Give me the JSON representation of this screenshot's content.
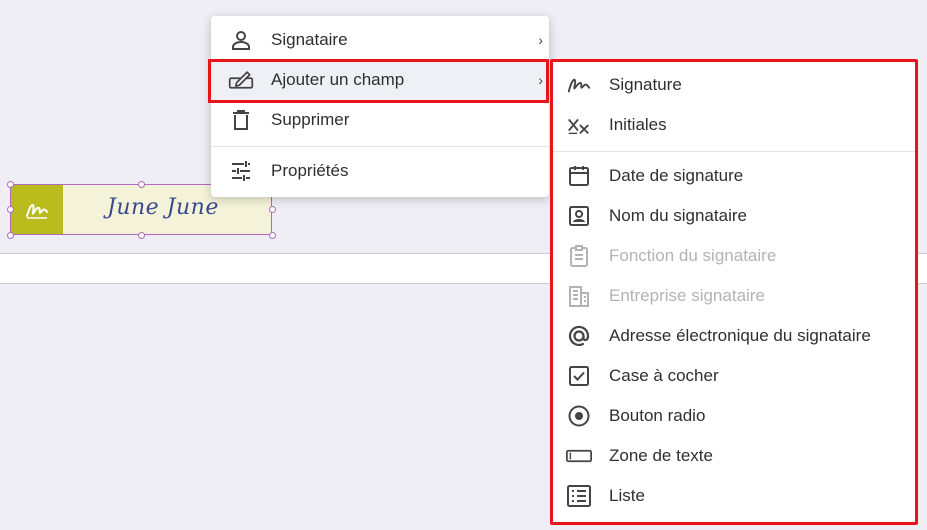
{
  "signature_field": {
    "signer_text": "June June",
    "badge_color": "#b9bc1c",
    "badge_icon": "signature-icon"
  },
  "context_menu": {
    "items": [
      {
        "label": "Signataire",
        "icon": "person-icon",
        "has_submenu": true
      },
      {
        "label": "Ajouter un champ",
        "icon": "add-field-icon",
        "has_submenu": true,
        "highlighted": true
      },
      {
        "label": "Supprimer",
        "icon": "trash-icon",
        "has_submenu": false
      },
      {
        "label": "Propriétés",
        "icon": "sliders-icon",
        "has_submenu": false
      }
    ],
    "chevron": "›"
  },
  "field_submenu": {
    "items": [
      {
        "label": "Signature",
        "icon": "signature-icon",
        "enabled": true
      },
      {
        "label": "Initiales",
        "icon": "initials-icon",
        "enabled": true
      },
      {
        "label": "Date de signature",
        "icon": "calendar-icon",
        "enabled": true
      },
      {
        "label": "Nom du signataire",
        "icon": "id-card-icon",
        "enabled": true
      },
      {
        "label": "Fonction du signataire",
        "icon": "clipboard-icon",
        "enabled": false
      },
      {
        "label": "Entreprise signataire",
        "icon": "building-icon",
        "enabled": false
      },
      {
        "label": "Adresse électronique du signataire",
        "icon": "at-icon",
        "enabled": true
      },
      {
        "label": "Case à cocher",
        "icon": "checkbox-icon",
        "enabled": true
      },
      {
        "label": "Bouton radio",
        "icon": "radio-icon",
        "enabled": true
      },
      {
        "label": "Zone de texte",
        "icon": "textbox-icon",
        "enabled": true
      },
      {
        "label": "Liste",
        "icon": "list-icon",
        "enabled": true
      }
    ]
  },
  "colors": {
    "highlight_border": "#e8141c",
    "disabled_text": "#b3b3b3",
    "signature_ink": "#3b4a8f"
  }
}
